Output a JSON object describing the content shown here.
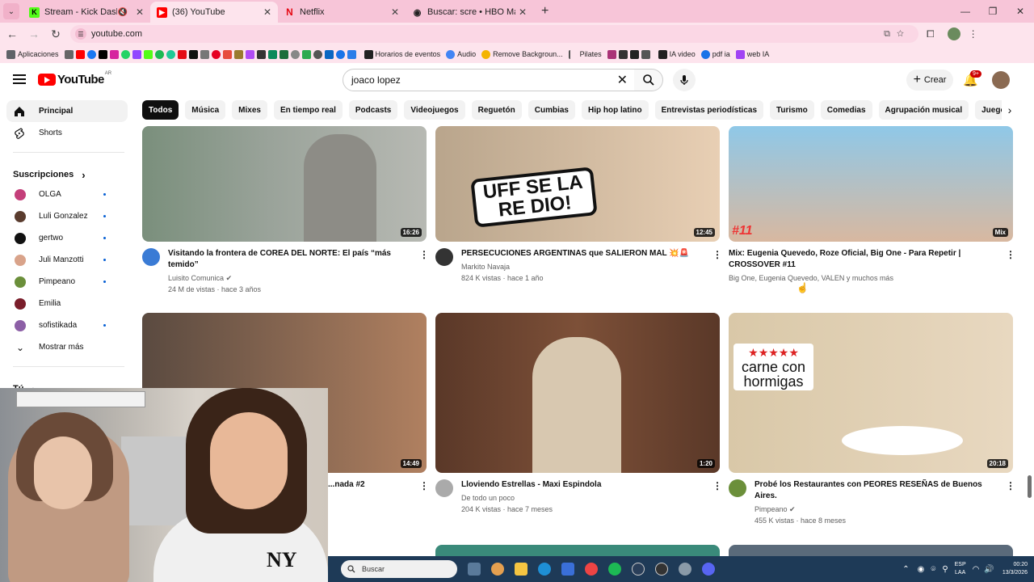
{
  "browser": {
    "tabs": [
      {
        "title": "Stream - Kick Dashboard",
        "color": "#53fc18",
        "glyph": "K",
        "muted": true
      },
      {
        "title": "(36) YouTube",
        "color": "#ff0000",
        "glyph": "▶",
        "active": true
      },
      {
        "title": "Netflix",
        "color": "#e50914",
        "glyph": "N"
      },
      {
        "title": "Buscar: scre • HBO Max",
        "color": "#222222",
        "glyph": "◉"
      }
    ],
    "url": "youtube.com",
    "bookmarks": [
      {
        "label": "Aplicaciones",
        "color": "#5f6368"
      },
      {
        "label": "Horarios de eventos",
        "color": "#222222"
      },
      {
        "label": "Audio",
        "color": "#4285f4"
      },
      {
        "label": "Remove Backgroun...",
        "color": "#f4b400"
      },
      {
        "label": "Pilates",
        "color": "#aa5577"
      },
      {
        "label": "IA video",
        "color": "#222222"
      },
      {
        "label": "pdf ia",
        "color": "#1a73e8"
      },
      {
        "label": "web IA",
        "color": "#a142f4"
      }
    ]
  },
  "youtube": {
    "logo": "YouTube",
    "country": "AR",
    "search_query": "joaco lopez",
    "create_label": "Crear",
    "notifications": "9+",
    "chips": [
      "Todos",
      "Música",
      "Mixes",
      "En tiempo real",
      "Podcasts",
      "Videojuegos",
      "Reguetón",
      "Cumbias",
      "Hip hop latino",
      "Entrevistas periodísticas",
      "Turismo",
      "Comedias",
      "Agrupación musical",
      "Juegos de aventura y acción"
    ],
    "sidebar": {
      "main": [
        {
          "label": "Principal",
          "icon": "home-icon"
        },
        {
          "label": "Shorts",
          "icon": "shorts-icon"
        }
      ],
      "subs_title": "Suscripciones",
      "subs": [
        {
          "label": "OLGA",
          "color": "#c43f7a"
        },
        {
          "label": "Luli Gonzalez",
          "color": "#5a3c2e"
        },
        {
          "label": "gertwo",
          "color": "#111111"
        },
        {
          "label": "Juli Manzotti",
          "color": "#d9a38a"
        },
        {
          "label": "Pimpeano",
          "color": "#6b8f3a"
        },
        {
          "label": "Emilia",
          "color": "#7a1e2b"
        },
        {
          "label": "sofistikada",
          "color": "#8c5fa6"
        }
      ],
      "show_more": "Mostrar más",
      "you": "Tú"
    },
    "videos": [
      {
        "title1": "Visitando la frontera de COREA DEL NORTE: El país “más",
        "title2": "temido”",
        "channel": "Luisito Comunica",
        "verified": true,
        "meta": "24 M de vistas · hace 3 años",
        "duration": "16:26",
        "thumb": "#8a9a8a",
        "avatar": "#3a7bd5"
      },
      {
        "title1": "PERSECUCIONES ARGENTINAS que SALIERON MAL 💥🚨",
        "title2": "",
        "channel": "Markito Navaja",
        "verified": false,
        "meta": "824 K vistas · hace 1 año",
        "duration": "12:45",
        "thumb": "#d8c4a8",
        "avatar": "#333333",
        "overlay1": "UFF SE LA",
        "overlay2": "RE DIO!"
      },
      {
        "title1": "Mix: Eugenia Quevedo, Roze Oficial, Big One - Para Repetir |",
        "title2": "CROSSOVER #11",
        "channel": "Big One, Eugenia Quevedo, VALEN y muchos más",
        "verified": false,
        "meta": "",
        "duration": "Mix",
        "thumb": "#7fb8d8",
        "avatar": "",
        "overlay1": "#11"
      },
      {
        "title1": "...nada #2",
        "title2": "",
        "channel": "",
        "verified": false,
        "meta": "",
        "duration": "14:49",
        "thumb": "#9a7058",
        "avatar": ""
      },
      {
        "title1": "Lloviendo Estrellas - Maxi Espindola",
        "title2": "",
        "channel": "De todo un poco",
        "verified": false,
        "meta": "204 K vistas · hace 7 meses",
        "duration": "1:20",
        "thumb": "#6a4530",
        "avatar": "#999999"
      },
      {
        "title1": "Probé los Restaurantes con PEORES RESEÑAS de Buenos",
        "title2": "Aires.",
        "channel": "Pimpeano",
        "verified": true,
        "meta": "455 K vistas · hace 8 meses",
        "duration": "20:18",
        "thumb": "#c8a888",
        "avatar": "#6b8f3a",
        "overlay1": "carne con",
        "overlay2": "hormigas"
      }
    ]
  },
  "taskbar": {
    "search": "Buscar",
    "lang1": "ESP",
    "lang2": "LAA",
    "time": "00:20",
    "date": "13/3/2026"
  }
}
